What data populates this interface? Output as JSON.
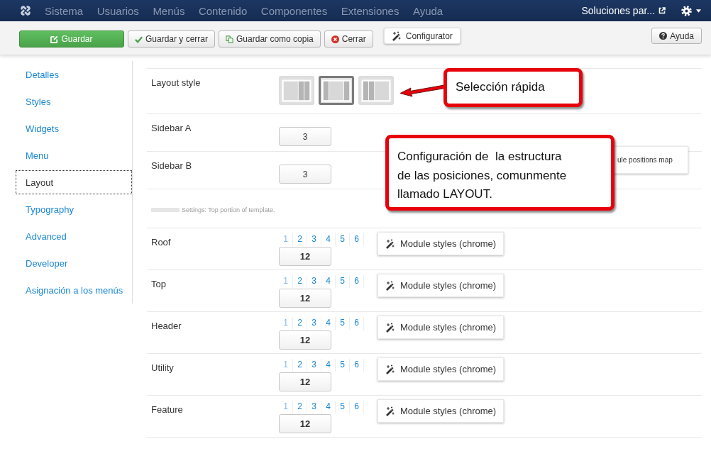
{
  "navbar": {
    "menu": [
      "Sistema",
      "Usuarios",
      "Menús",
      "Contenido",
      "Componentes",
      "Extensiones",
      "Ayuda"
    ],
    "site_link": "Soluciones par..."
  },
  "toolbar": {
    "buttons": [
      {
        "label": "Guardar",
        "kind": "save"
      },
      {
        "label": "Guardar y cerrar",
        "kind": "apply"
      },
      {
        "label": "Guardar como copia",
        "kind": "copy"
      },
      {
        "label": "Cerrar",
        "kind": "close"
      },
      {
        "label": "Configurator",
        "kind": "tool"
      }
    ],
    "help": "Ayuda"
  },
  "sidebar": {
    "items": [
      {
        "label": "Detalles",
        "selected": false
      },
      {
        "label": "Styles",
        "selected": false
      },
      {
        "label": "Widgets",
        "selected": false
      },
      {
        "label": "Menu",
        "selected": false
      },
      {
        "label": "Layout",
        "selected": true
      },
      {
        "label": "Typography",
        "selected": false
      },
      {
        "label": "Advanced",
        "selected": false
      },
      {
        "label": "Developer",
        "selected": false
      },
      {
        "label": "Asignación a los menús",
        "selected": false
      }
    ]
  },
  "layout_style": {
    "label": "Layout style",
    "options": [
      {
        "kind": "right",
        "selected": false
      },
      {
        "kind": "both",
        "selected": true
      },
      {
        "kind": "left",
        "selected": false
      }
    ]
  },
  "sidebars": [
    {
      "label": "Sidebar A",
      "value": "3"
    },
    {
      "label": "Sidebar B",
      "value": "3"
    }
  ],
  "positions_map_button": "ule positions map",
  "section_note": "Settings: Top portion of template.",
  "positions": [
    {
      "label": "Roof",
      "columns": [
        {
          "label": "1",
          "selected": true
        },
        {
          "label": "2",
          "selected": false
        },
        {
          "label": "3",
          "selected": false
        },
        {
          "label": "4",
          "selected": false
        },
        {
          "label": "5",
          "selected": false
        },
        {
          "label": "6",
          "selected": false
        }
      ],
      "value": "12",
      "styles_button": "Module styles (chrome)"
    },
    {
      "label": "Top",
      "columns": [
        {
          "label": "1",
          "selected": true
        },
        {
          "label": "2",
          "selected": false
        },
        {
          "label": "3",
          "selected": false
        },
        {
          "label": "4",
          "selected": false
        },
        {
          "label": "5",
          "selected": false
        },
        {
          "label": "6",
          "selected": false
        }
      ],
      "value": "12",
      "styles_button": "Module styles (chrome)"
    },
    {
      "label": "Header",
      "columns": [
        {
          "label": "1",
          "selected": true
        },
        {
          "label": "2",
          "selected": false
        },
        {
          "label": "3",
          "selected": false
        },
        {
          "label": "4",
          "selected": false
        },
        {
          "label": "5",
          "selected": false
        },
        {
          "label": "6",
          "selected": false
        }
      ],
      "value": "12",
      "styles_button": "Module styles (chrome)"
    },
    {
      "label": "Utility",
      "columns": [
        {
          "label": "1",
          "selected": true
        },
        {
          "label": "2",
          "selected": false
        },
        {
          "label": "3",
          "selected": false
        },
        {
          "label": "4",
          "selected": false
        },
        {
          "label": "5",
          "selected": false
        },
        {
          "label": "6",
          "selected": false
        }
      ],
      "value": "12",
      "styles_button": "Module styles (chrome)"
    },
    {
      "label": "Feature",
      "columns": [
        {
          "label": "1",
          "selected": true
        },
        {
          "label": "2",
          "selected": false
        },
        {
          "label": "3",
          "selected": false
        },
        {
          "label": "4",
          "selected": false
        },
        {
          "label": "5",
          "selected": false
        },
        {
          "label": "6",
          "selected": false
        }
      ],
      "value": "12",
      "styles_button": "Module styles (chrome)"
    }
  ],
  "callouts": [
    {
      "text": "Selección rápida"
    },
    {
      "text": "Configuración de  la estructura\nde las posiciones, comunmente\nllamado LAYOUT."
    }
  ]
}
